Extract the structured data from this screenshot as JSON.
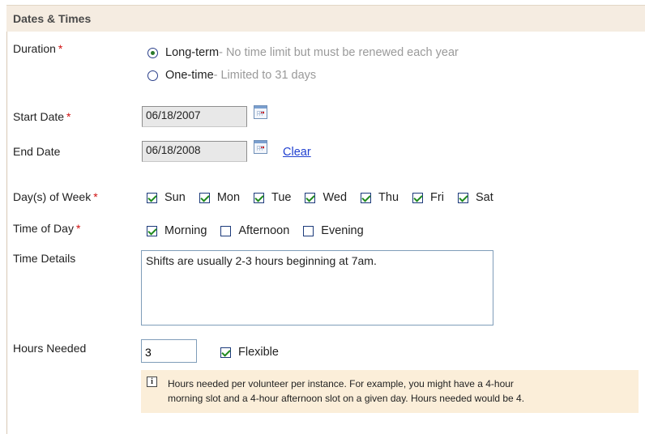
{
  "section": {
    "title": "Dates & Times"
  },
  "required_mark": "*",
  "duration": {
    "label": "Duration",
    "options": [
      {
        "label": "Long-term",
        "hint": " - No time limit but must be renewed each year",
        "selected": true
      },
      {
        "label": "One-time",
        "hint": " - Limited to 31 days",
        "selected": false
      }
    ]
  },
  "start_date": {
    "label": "Start Date",
    "value": "06/18/2007"
  },
  "end_date": {
    "label": "End Date",
    "value": "06/18/2008",
    "clear_label": "Clear"
  },
  "days_of_week": {
    "label": "Day(s) of Week",
    "days": [
      {
        "label": "Sun",
        "checked": true
      },
      {
        "label": "Mon",
        "checked": true
      },
      {
        "label": "Tue",
        "checked": true
      },
      {
        "label": "Wed",
        "checked": true
      },
      {
        "label": "Thu",
        "checked": true
      },
      {
        "label": "Fri",
        "checked": true
      },
      {
        "label": "Sat",
        "checked": true
      }
    ]
  },
  "time_of_day": {
    "label": "Time of Day",
    "options": [
      {
        "label": "Morning",
        "checked": true
      },
      {
        "label": "Afternoon",
        "checked": false
      },
      {
        "label": "Evening",
        "checked": false
      }
    ]
  },
  "time_details": {
    "label": "Time Details",
    "value": "Shifts are usually 2-3 hours beginning at 7am."
  },
  "hours_needed": {
    "label": "Hours Needed",
    "value": "3",
    "flexible_label": "Flexible",
    "flexible_checked": true
  },
  "info": {
    "icon": "info-icon",
    "line1": "Hours needed per volunteer per instance. For example, you might have a 4-hour",
    "line2": "morning slot and a 4-hour afternoon slot on a given day. Hours needed would be 4."
  },
  "colors": {
    "header_bg": "#f5ece1",
    "info_bg": "#fbeed9",
    "required": "#d01010",
    "link": "#1f3fd0",
    "check": "#1f8a1f"
  }
}
